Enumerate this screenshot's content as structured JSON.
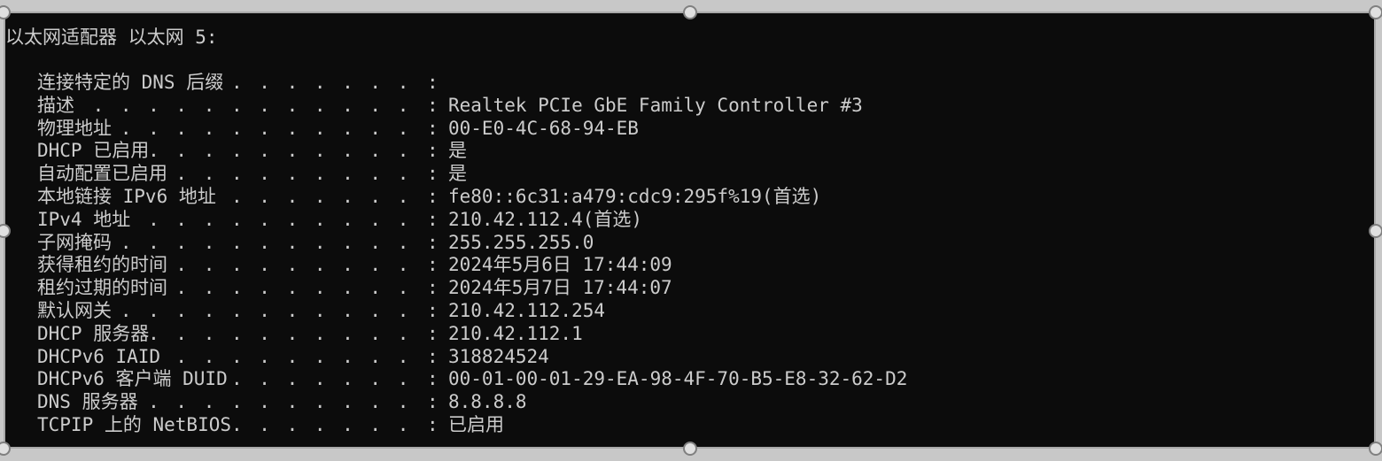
{
  "adapter": {
    "header": "以太网适配器 以太网 5:"
  },
  "rows": [
    {
      "label": "连接特定的 DNS 后缀",
      "value": ""
    },
    {
      "label": "描述",
      "value": "Realtek PCIe GbE Family Controller #3"
    },
    {
      "label": "物理地址",
      "value": "00-E0-4C-68-94-EB"
    },
    {
      "label": "DHCP 已启用",
      "value": "是"
    },
    {
      "label": "自动配置已启用",
      "value": "是"
    },
    {
      "label": "本地链接 IPv6 地址",
      "value": "fe80::6c31:a479:cdc9:295f%19(首选)"
    },
    {
      "label": "IPv4 地址",
      "value": "210.42.112.4(首选)"
    },
    {
      "label": "子网掩码",
      "value": "255.255.255.0"
    },
    {
      "label": "获得租约的时间",
      "value": "2024年5月6日 17:44:09"
    },
    {
      "label": "租约过期的时间",
      "value": "2024年5月7日 17:44:07"
    },
    {
      "label": "默认网关",
      "value": "210.42.112.254"
    },
    {
      "label": "DHCP 服务器",
      "value": "210.42.112.1"
    },
    {
      "label": "DHCPv6 IAID",
      "value": "318824524"
    },
    {
      "label": "DHCPv6 客户端 DUID",
      "value": "00-01-00-01-29-EA-98-4F-70-B5-E8-32-62-D2"
    },
    {
      "label": "DNS 服务器",
      "value": "8.8.8.8"
    },
    {
      "label": "TCPIP 上的 NetBIOS",
      "value": "已启用"
    }
  ],
  "separator": ":",
  "dot_leader": ". . . . . . . . . . . . . . . . . . . . . . . . . . . . . ."
}
